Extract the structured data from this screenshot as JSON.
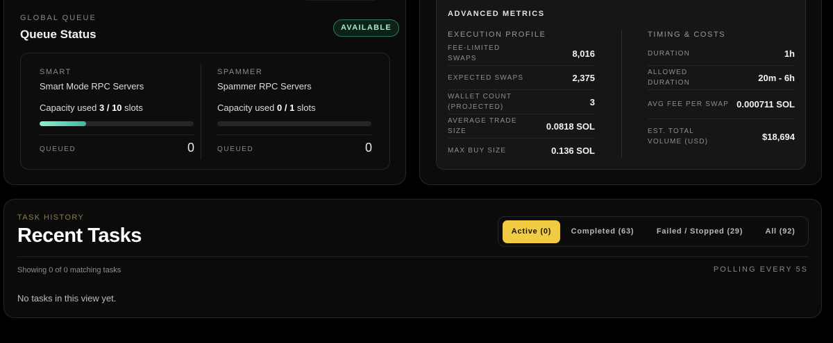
{
  "queue": {
    "eyebrow": "GLOBAL QUEUE",
    "title": "Queue Status",
    "status_badge": "AVAILABLE",
    "smart": {
      "eyebrow": "SMART",
      "name": "Smart Mode RPC Servers",
      "capacity_prefix": "Capacity used ",
      "capacity_value": "3 / 10",
      "capacity_suffix": " slots",
      "capacity_fraction": 0.3,
      "queued_label": "QUEUED",
      "queued_value": "0"
    },
    "spammer": {
      "eyebrow": "SPAMMER",
      "name": "Spammer RPC Servers",
      "capacity_prefix": "Capacity used ",
      "capacity_value": "0 / 1",
      "capacity_suffix": " slots",
      "capacity_fraction": 0.0,
      "queued_label": "QUEUED",
      "queued_value": "0"
    }
  },
  "metrics": {
    "title": "ADVANCED METRICS",
    "execution": {
      "title": "EXECUTION PROFILE",
      "rows": [
        {
          "label": "FEE-LIMITED SWAPS",
          "value": "8,016"
        },
        {
          "label": "EXPECTED SWAPS",
          "value": "2,375"
        },
        {
          "label": "WALLET COUNT (PROJECTED)",
          "value": "3"
        },
        {
          "label": "AVERAGE TRADE SIZE",
          "value": "0.0818 SOL"
        },
        {
          "label": "MAX BUY SIZE",
          "value": "0.136 SOL"
        }
      ]
    },
    "timing": {
      "title": "TIMING & COSTS",
      "rows": [
        {
          "label": "DURATION",
          "value": "1h"
        },
        {
          "label": "ALLOWED DURATION",
          "value": "20m - 6h"
        },
        {
          "label": "AVG FEE PER SWAP",
          "value": "0.000711 SOL"
        },
        {
          "label": "EST. TOTAL VOLUME (USD)",
          "value": "$18,694"
        }
      ]
    }
  },
  "tasks": {
    "eyebrow": "TASK HISTORY",
    "title": "Recent Tasks",
    "filters": [
      {
        "label": "Active (0)",
        "active": true
      },
      {
        "label": "Completed (63)",
        "active": false
      },
      {
        "label": "Failed / Stopped (29)",
        "active": false
      },
      {
        "label": "All (92)",
        "active": false
      }
    ],
    "showing": "Showing 0 of 0 matching tasks",
    "polling": "POLLING EVERY 5S",
    "empty": "No tasks in this view yet."
  },
  "colors": {
    "accent_yellow": "#f2cb45",
    "badge_green": "#a7e8c9",
    "bar_fill": "#3fb6a3"
  }
}
